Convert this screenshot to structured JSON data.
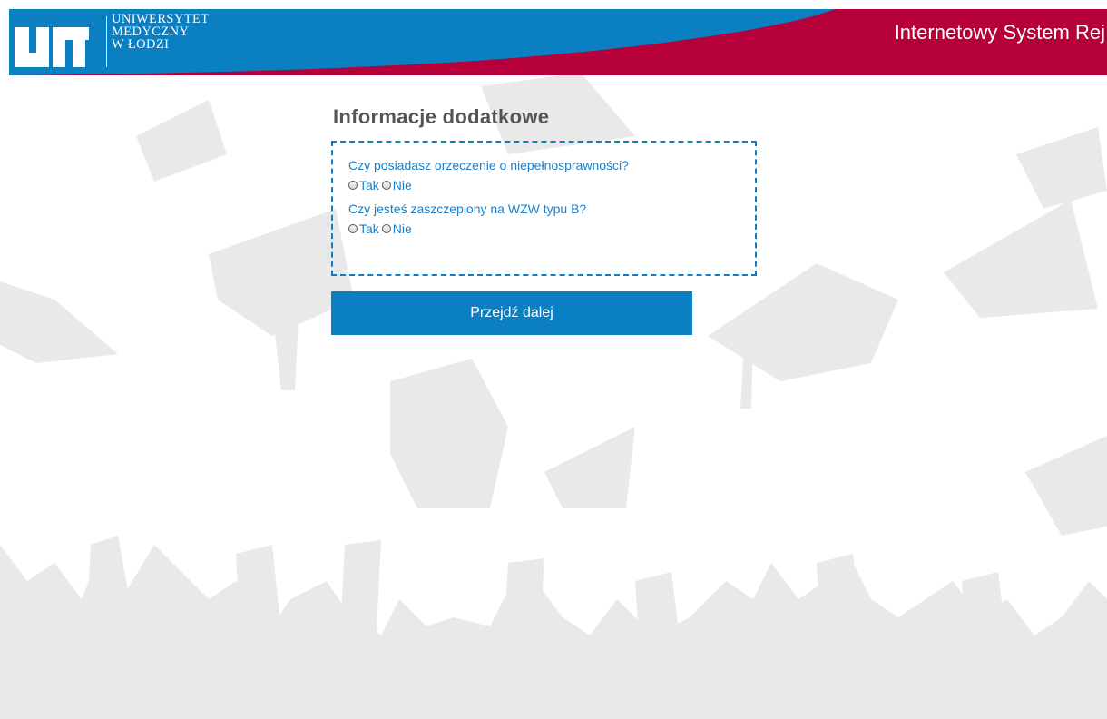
{
  "header": {
    "logo_letters": "um",
    "logo_lines": [
      "UNIWERSYTET",
      "MEDYCZNY",
      "W ŁODZI"
    ],
    "system_title": "Internetowy System Rej",
    "colors": {
      "blue": "#0a7fc1",
      "crimson": "#b5003a"
    }
  },
  "form": {
    "title": "Informacje dodatkowe",
    "questions": [
      {
        "label": "Czy posiadasz orzeczenie o niepełnosprawności?",
        "options": [
          "Tak",
          "Nie"
        ],
        "selected": null
      },
      {
        "label": "Czy jesteś zaszczepiony na WZW typu B?",
        "options": [
          "Tak",
          "Nie"
        ],
        "selected": null
      }
    ],
    "submit_label": "Przejdź dalej"
  },
  "background": {
    "motif": "graduation-caps-silhouettes"
  }
}
